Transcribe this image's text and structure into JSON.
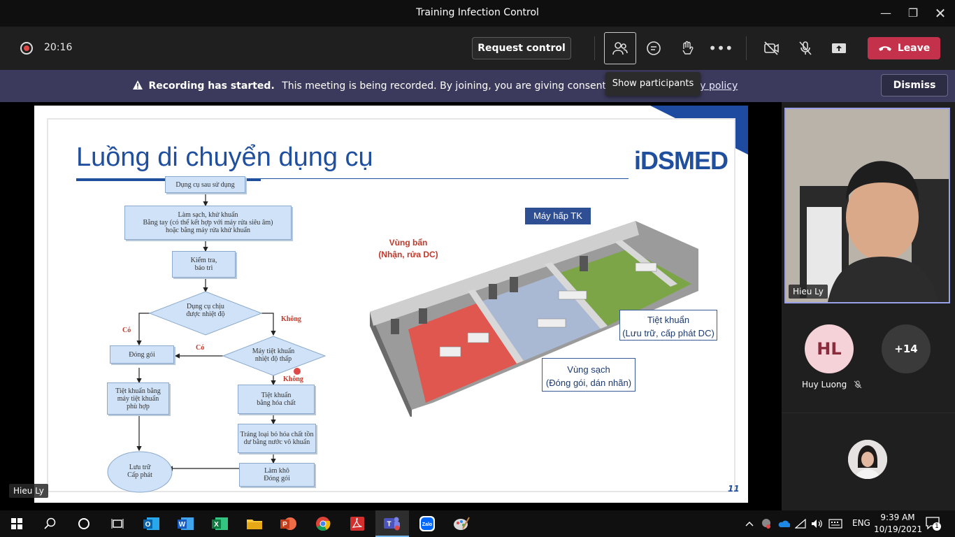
{
  "window": {
    "title": "Training Infection Control"
  },
  "toolbar": {
    "timer": "20:16",
    "request_control": "Request control",
    "leave": "Leave",
    "tooltip": "Show participants"
  },
  "banner": {
    "bold": "Recording has started.",
    "text": "This meeting is being recorded. By joining, you are giving consent for this meetin",
    "link": "acy policy",
    "dismiss": "Dismiss"
  },
  "slide": {
    "title": "Luồng di chuyển dụng cụ",
    "logo": "iDSMED",
    "page_number": "11",
    "flow": {
      "n1": "Dụng cụ sau sử dụng",
      "n2a": "Làm sạch, khử khuẩn",
      "n2b": "Bằng tay (có thể kết hợp với máy rửa siêu âm)",
      "n2c": "hoặc bằng máy rửa khử khuẩn",
      "n3a": "Kiểm tra,",
      "n3b": "bảo trì",
      "d1a": "Dụng cụ chịu",
      "d1b": "được nhiệt độ",
      "d2a": "Máy tiệt khuẩn",
      "d2b": "nhiệt độ thấp",
      "n4": "Đóng gói",
      "n5a": "Tiệt khuẩn bằng",
      "n5b": "máy tiệt khuẩn",
      "n5c": "phù hợp",
      "n6a": "Tiệt khuẩn",
      "n6b": "bằng hóa chất",
      "n7a": "Tráng loại bỏ hóa chất tồn",
      "n7b": "dư bằng nước vô khuẩn",
      "n8a": "Làm khô",
      "n8b": "Đóng gói",
      "n9a": "Lưu trữ",
      "n9b": "Cấp phát",
      "co1": "Có",
      "co2": "Có",
      "khong1": "Không",
      "khong2": "Không"
    },
    "diagram": {
      "autoclave": "Máy hấp TK",
      "dirty_a": "Vùng bẩn",
      "dirty_b": "(Nhận, rửa DC)",
      "clean_a": "Vùng sạch",
      "clean_b": "(Đóng gói, dán nhãn)",
      "sterile_a": "Tiệt khuẩn",
      "sterile_b": "(Lưu trữ, cấp phát DC)"
    }
  },
  "stage": {
    "presenter": "Hieu Ly"
  },
  "participants": {
    "camera_name": "Hieu Ly",
    "hl_initials": "HL",
    "hl_name": "Huy Luong",
    "more": "+14"
  },
  "taskbar": {
    "lang": "ENG",
    "time": "9:39 AM",
    "date": "10/19/2021",
    "notifications": "1"
  },
  "colors": {
    "leave": "#c4314b",
    "banner": "#3b3a5c",
    "accent": "#9aa0e8"
  }
}
